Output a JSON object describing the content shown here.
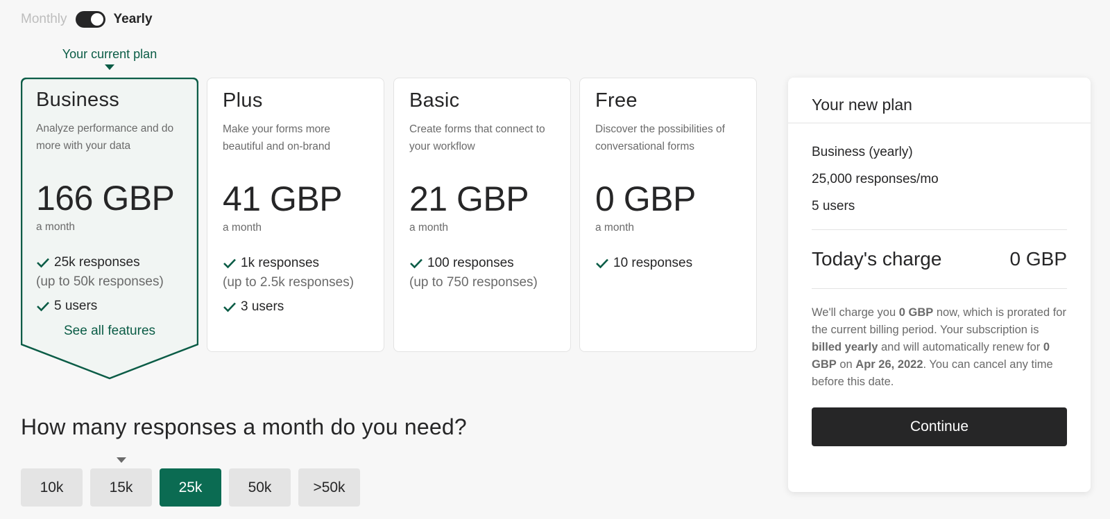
{
  "billing": {
    "monthly_label": "Monthly",
    "yearly_label": "Yearly",
    "selected": "Yearly"
  },
  "current_plan_label": "Your current plan",
  "plans": [
    {
      "name": "Business",
      "description": "Analyze performance and do more with your data",
      "price": "166 GBP",
      "period": "a month",
      "responses": "25k responses",
      "responses_note": "(up to 50k responses)",
      "users": "5 users",
      "see_all": "See all features"
    },
    {
      "name": "Plus",
      "description": "Make your forms more beautiful and on-brand",
      "price": "41 GBP",
      "period": "a month",
      "responses": "1k responses",
      "responses_note": "(up to 2.5k responses)",
      "users": "3 users"
    },
    {
      "name": "Basic",
      "description": "Create forms that connect to your workflow",
      "price": "21 GBP",
      "period": "a month",
      "responses": "100 responses",
      "responses_note": "(up to 750 responses)"
    },
    {
      "name": "Free",
      "description": "Discover the possibilities of conversational forms",
      "price": "0 GBP",
      "period": "a month",
      "responses": "10 responses"
    }
  ],
  "responses_selector": {
    "question": "How many responses a month do you need?",
    "options": [
      "10k",
      "15k",
      "25k",
      "50k",
      ">50k"
    ],
    "selected": "25k"
  },
  "summary": {
    "title": "Your new plan",
    "plan": "Business (yearly)",
    "responses": "25,000 responses/mo",
    "users": "5 users",
    "charge_label": "Today's charge",
    "charge_value": "0 GBP",
    "note": {
      "p1": "We'll charge you ",
      "b1": "0 GBP",
      "p2": " now, which is prorated for the current billing period. Your subscription is ",
      "b2": "billed yearly",
      "p3": " and will automatically renew for ",
      "b3": "0 GBP",
      "p4": " on ",
      "b4": "Apr 26, 2022",
      "p5": ". You can cancel any time before this date."
    },
    "continue_label": "Continue"
  },
  "colors": {
    "accent": "#0b5c46",
    "selected_button": "#0b6b52",
    "dark": "#262627"
  }
}
